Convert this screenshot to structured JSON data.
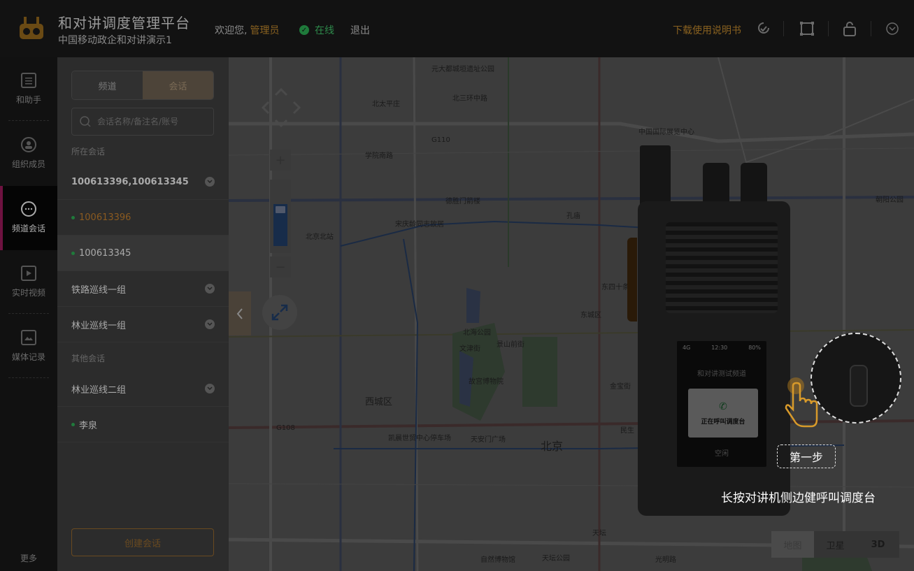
{
  "header": {
    "title": "和对讲调度管理平台",
    "subtitle": "中国移动政企和对讲演示1",
    "welcome": "欢迎您,",
    "user": "管理员",
    "status": "在线",
    "logout": "退出",
    "download": "下载使用说明书",
    "icons": [
      "location-icon",
      "fullscreen-icon",
      "lock-icon",
      "chevron-down-icon"
    ]
  },
  "nav": {
    "items": [
      {
        "label": "和助手",
        "icon": "list-icon"
      },
      {
        "label": "组织成员",
        "icon": "person-icon"
      },
      {
        "label": "频道会话",
        "icon": "chat-icon"
      },
      {
        "label": "实时视频",
        "icon": "video-icon"
      },
      {
        "label": "媒体记录",
        "icon": "image-icon"
      }
    ],
    "more": "更多"
  },
  "panel": {
    "tabs": [
      "频道",
      "会话"
    ],
    "active_tab": "会话",
    "search_placeholder": "会话名称/备注名/账号",
    "section_current": "所在会话",
    "section_other": "其他会话",
    "sessions": [
      {
        "label": "100613396,100613345",
        "type": "group"
      },
      {
        "label": "100613396",
        "type": "member-online-self"
      },
      {
        "label": "100613345",
        "type": "member-online"
      },
      {
        "label": "铁路巡线一组",
        "type": "group"
      },
      {
        "label": "林业巡线一组",
        "type": "group"
      }
    ],
    "other_sessions": [
      {
        "label": "林业巡线二组",
        "type": "group"
      },
      {
        "label": "李泉",
        "type": "member-online"
      }
    ],
    "create_button": "创建会话"
  },
  "map": {
    "labels": {
      "l1": "元大都城垣遗址公园",
      "l2": "北三环中路",
      "l3": "北太平庄",
      "l4": "中国国际展览中心",
      "l5": "德胜门箭楼",
      "l6": "宋庆龄同志故居",
      "l7": "北京北站",
      "l8": "北海公园",
      "l9": "故宫博物院",
      "l10": "西城区",
      "l11": "东城区",
      "l12": "北京",
      "l13": "凯晨世贸中心停车场",
      "l14": "天安门广场",
      "l15": "天坛公园",
      "l16": "自然博物馆",
      "l17": "朝阳公园",
      "l18": "学院南路",
      "l19": "孔庙",
      "l20": "东四十条",
      "l21": "G110",
      "l22": "G108",
      "l23": "文津街",
      "l24": "景山前街",
      "l25": "金宝街",
      "l26": "民生",
      "l27": "天坛",
      "l28": "光明路"
    },
    "types": [
      "地图",
      "卫星",
      "3D"
    ],
    "active_type": "地图"
  },
  "device": {
    "signal": "4G",
    "time": "12:30",
    "battery": "80%",
    "channel_name": "和对讲测试频道",
    "calling_text": "正在呼叫调度台",
    "idle_text": "空闲"
  },
  "guide": {
    "step": "第一步",
    "instruction": "长按对讲机侧边健呼叫调度台"
  }
}
